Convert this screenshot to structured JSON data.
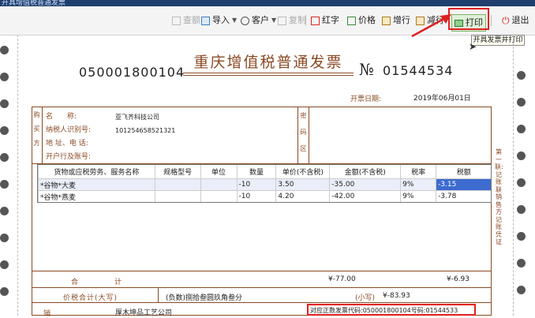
{
  "window": {
    "title": "开具增值税普通发票"
  },
  "toolbar": {
    "cancel_label": "查额",
    "import_label": "导入",
    "customer_label": "客户",
    "copy_label": "复制",
    "red_label": "红字",
    "price_label": "价格",
    "add_line_label": "增行",
    "del_line_label": "减行",
    "print_label": "打印",
    "exit_label": "退出",
    "print_tooltip": "开具发票并打印"
  },
  "invoice": {
    "code": "050001800104",
    "title": "重庆增值税普通发票",
    "no_symbol": "№",
    "number": "01544534",
    "date_label": "开票日期:",
    "date": "2019年06月01日",
    "buyer_side_label": [
      "购",
      "买",
      "方"
    ],
    "buyer_labels": {
      "name": "名　　称:",
      "tax_id": "纳税人识别号:",
      "address": "地 址、电 话:",
      "bank": "开户行及账号:"
    },
    "buyer": {
      "name": "亚飞齐科技公司",
      "tax_id": "101254658521321",
      "address": "",
      "bank": ""
    },
    "mima_label": [
      "密",
      "码",
      "区"
    ],
    "columns": [
      "货物或应税劳务、服务名称",
      "规格型号",
      "单位",
      "数量",
      "单价(不含税)",
      "金额(不含税)",
      "税率",
      "税额"
    ],
    "rows": [
      {
        "name": "*谷物*大麦",
        "spec": "",
        "unit": "",
        "qty": "-10",
        "price": "3.50",
        "amount": "-35.00",
        "rate": "9%",
        "tax": "-3.15"
      },
      {
        "name": "*谷物*燕麦",
        "spec": "",
        "unit": "",
        "qty": "-10",
        "price": "4.20",
        "amount": "-42.00",
        "rate": "9%",
        "tax": "-3.78"
      }
    ],
    "total_label_a": "合",
    "total_label_b": "计",
    "total_amount": "¥-77.00",
    "total_tax": "¥-6.93",
    "grand_label": "价税合计(大写)",
    "grand_upper": "(负数)捌拾叁圆玖角叁分",
    "grand_lower_label": "(小写)",
    "grand_lower": "¥-83.93",
    "seller_name": "厚木坤品工艺公司",
    "remark": "对应正数发票代码:050001800104号码:01544533",
    "side_note": "第一联:记账联 销售方记账凭证"
  }
}
